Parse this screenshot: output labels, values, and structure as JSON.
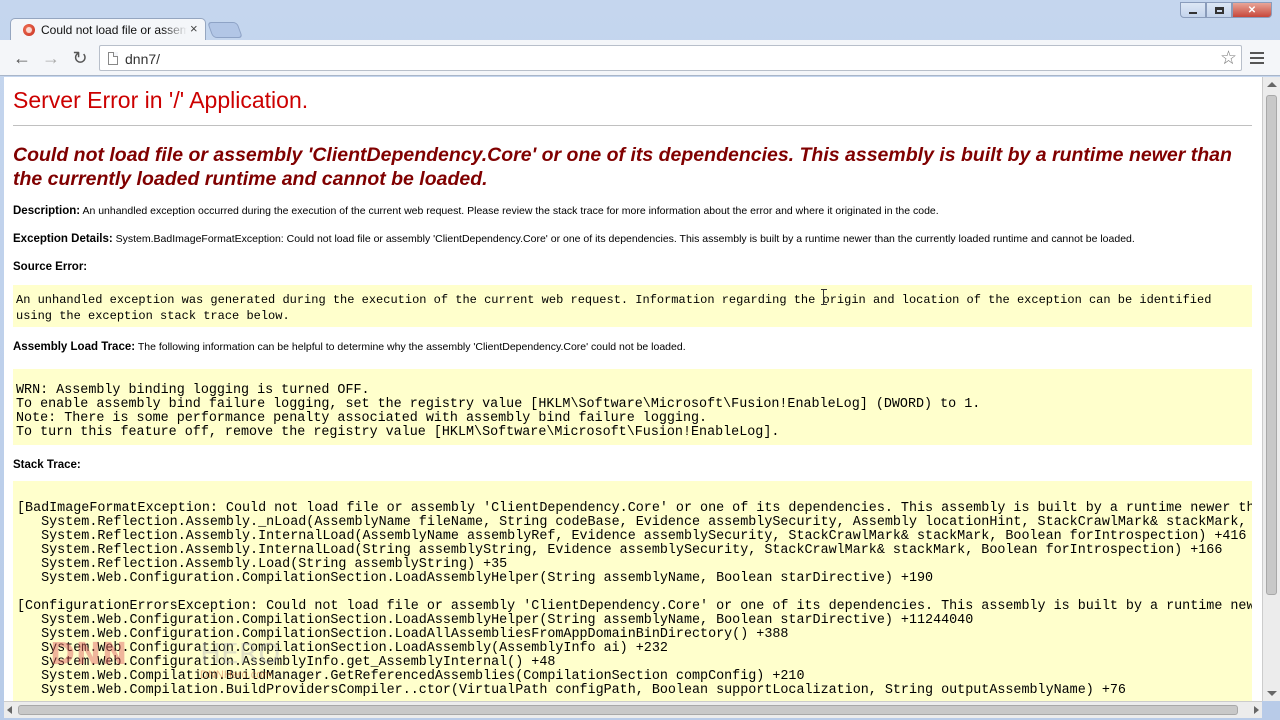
{
  "browser": {
    "tab_title": "Could not load file or assembly",
    "tab_close": "×",
    "url": "dnn7/",
    "back_glyph": "←",
    "forward_glyph": "→",
    "reload_glyph": "↻",
    "star_glyph": "☆",
    "close_glyph": "✕",
    "icons": [
      "favicon-icon",
      "back-arrow-icon",
      "forward-arrow-icon",
      "reload-icon",
      "page-icon",
      "star-icon",
      "menu-icon"
    ]
  },
  "page": {
    "title": "Server Error in '/' Application.",
    "error_message": "Could not load file or assembly 'ClientDependency.Core' or one of its dependencies. This assembly is built by a runtime newer than the currently loaded runtime and cannot be loaded.",
    "description_label": "Description:",
    "description_text": "An unhandled exception occurred during the execution of the current web request. Please review the stack trace for more information about the error and where it originated in the code.",
    "exception_label": "Exception Details:",
    "exception_text": "System.BadImageFormatException: Could not load file or assembly 'ClientDependency.Core' or one of its dependencies. This assembly is built by a runtime newer than the currently loaded runtime and cannot be loaded.",
    "source_error_label": "Source Error:",
    "source_error_text": "An unhandled exception was generated during the execution of the current web request. Information regarding the origin and location of the exception can be identified using the exception stack trace below.",
    "assembly_label": "Assembly Load Trace:",
    "assembly_text": "The following information can be helpful to determine why the assembly 'ClientDependency.Core' could not be loaded.",
    "assembly_trace": "WRN: Assembly binding logging is turned OFF.\nTo enable assembly bind failure logging, set the registry value [HKLM\\Software\\Microsoft\\Fusion!EnableLog] (DWORD) to 1.\nNote: There is some performance penalty associated with assembly bind failure logging.\nTo turn this feature off, remove the registry value [HKLM\\Software\\Microsoft\\Fusion!EnableLog].",
    "stack_label": "Stack Trace:",
    "stack_trace": "[BadImageFormatException: Could not load file or assembly 'ClientDependency.Core' or one of its dependencies. This assembly is built by a runtime newer than\n   System.Reflection.Assembly._nLoad(AssemblyName fileName, String codeBase, Evidence assemblySecurity, Assembly locationHint, StackCrawlMark& stackMark, Bo\n   System.Reflection.Assembly.InternalLoad(AssemblyName assemblyRef, Evidence assemblySecurity, StackCrawlMark& stackMark, Boolean forIntrospection) +416\n   System.Reflection.Assembly.InternalLoad(String assemblyString, Evidence assemblySecurity, StackCrawlMark& stackMark, Boolean forIntrospection) +166\n   System.Reflection.Assembly.Load(String assemblyString) +35\n   System.Web.Configuration.CompilationSection.LoadAssemblyHelper(String assemblyName, Boolean starDirective) +190\n\n[ConfigurationErrorsException: Could not load file or assembly 'ClientDependency.Core' or one of its dependencies. This assembly is built by a runtime newer\n   System.Web.Configuration.CompilationSection.LoadAssemblyHelper(String assemblyName, Boolean starDirective) +11244040\n   System.Web.Configuration.CompilationSection.LoadAllAssembliesFromAppDomainBinDirectory() +388\n   System.Web.Configuration.CompilationSection.LoadAssembly(AssemblyInfo ai) +232\n   System.Web.Configuration.AssemblyInfo.get_AssemblyInternal() +48\n   System.Web.Compilation.BuildManager.GetReferencedAssemblies(CompilationSection compConfig) +210\n   System.Web.Compilation.BuildProvidersCompiler..ctor(VirtualPath configPath, Boolean supportLocalization, String outputAssemblyName) +76"
  },
  "watermark": {
    "brand": "DNN",
    "hero": "HERO",
    "sub": "DNNHero.com"
  },
  "colors": {
    "title_red": "#cc0000",
    "message_maroon": "#800000",
    "code_background": "#ffffcc"
  }
}
